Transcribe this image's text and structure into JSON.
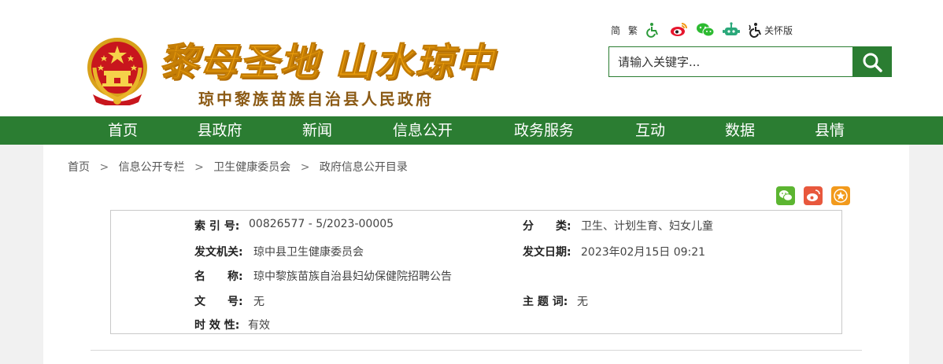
{
  "header": {
    "slogan": "黎母圣地 山水琼中",
    "gov_name": "琼中黎族苗族自治县人民政府",
    "tools": {
      "simplified": "简",
      "traditional": "繁",
      "care_mode": "关怀版"
    },
    "search": {
      "placeholder": "请输入关键字..."
    }
  },
  "nav": {
    "items": [
      "首页",
      "县政府",
      "新闻",
      "信息公开",
      "政务服务",
      "互动",
      "数据",
      "县情"
    ]
  },
  "breadcrumb": [
    "首页",
    "信息公开专栏",
    "卫生健康委员会",
    "政府信息公开目录"
  ],
  "breadcrumb_sep": ">",
  "info": {
    "index_label": "索 引 号:",
    "index_value": "00826577 - 5/2023-00005",
    "category_label": "分　　类:",
    "category_value": "卫生、计划生育、妇女儿童",
    "issuer_label": "发文机关:",
    "issuer_value": "琼中县卫生健康委员会",
    "date_label": "发文日期:",
    "date_value": "2023年02月15日 09:21",
    "title_label": "名　　称:",
    "title_value": "琼中黎族苗族自治县妇幼保健院招聘公告",
    "docno_label": "文　　号:",
    "docno_value": "无",
    "keywords_label": "主 题 词:",
    "keywords_value": "无",
    "validity_label": "时 效 性:",
    "validity_value": "有效"
  },
  "colors": {
    "brand_green": "#2b7d32",
    "slogan_gold": "#f0a20e",
    "wechat_green": "#5cb531",
    "weibo_red": "#e8583d",
    "favorite_orange": "#f29a1c"
  },
  "icons": [
    "national-emblem",
    "wheelchair-icon",
    "weibo-icon",
    "wechat-icon",
    "robot-icon",
    "care-mode-icon",
    "search-icon",
    "favorite-star-icon"
  ]
}
